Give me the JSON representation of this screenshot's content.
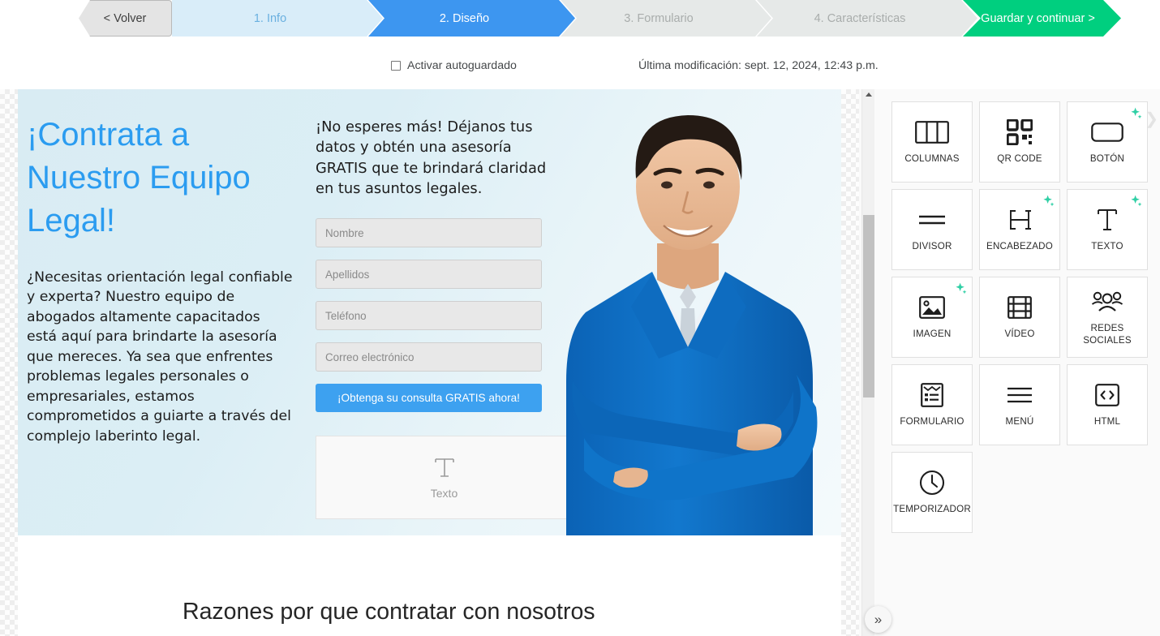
{
  "topbar": {
    "back_label": "< Volver",
    "steps": [
      {
        "label": "1. Info",
        "state": "done"
      },
      {
        "label": "2. Diseño",
        "state": "active"
      },
      {
        "label": "3. Formulario",
        "state": "pending"
      },
      {
        "label": "4. Características",
        "state": "pending"
      }
    ],
    "save_label": "Guardar y continuar >",
    "autosave_label": "Activar autoguardado",
    "autosave_checked": false,
    "last_modified": "Última modificación: sept. 12, 2024, 12:43 p.m."
  },
  "canvas": {
    "hero": {
      "heading": "¡Contrata a Nuestro Equipo Legal!",
      "paragraph": "¿Necesitas orientación legal confiable y experta? Nuestro equipo de abogados altamente capacitados está aquí para brindarte la asesoría que mereces. Ya sea que enfrentes problemas legales personales o empresariales, estamos comprometidos a guiarte a través del complejo laberinto legal.",
      "form_lead": "¡No esperes más! Déjanos tus datos y obtén una asesoría GRATIS que te brindará claridad en tus asuntos legales.",
      "fields": [
        {
          "placeholder": "Nombre"
        },
        {
          "placeholder": "Apellidos"
        },
        {
          "placeholder": "Teléfono"
        },
        {
          "placeholder": "Correo electrónico"
        }
      ],
      "cta_label": "¡Obtenga su consulta GRATIS ahora!",
      "text_block_label": "Texto",
      "text_block_icon": "text-t-icon"
    },
    "section_two_title": "Razones por que contratar con nosotros"
  },
  "scroll": {
    "up_arrow_icon": "caret-up-icon",
    "expand_icon": "double-chevron-right-icon",
    "expand_label": "»"
  },
  "panel": {
    "collapse_icon": "chevron-right-icon",
    "widgets": [
      {
        "label": "COLUMNAS",
        "icon": "columns-icon",
        "ai": false
      },
      {
        "label": "QR CODE",
        "icon": "qr-code-icon",
        "ai": false
      },
      {
        "label": "BOTÓN",
        "icon": "button-icon",
        "ai": true
      },
      {
        "label": "DIVISOR",
        "icon": "divider-icon",
        "ai": false
      },
      {
        "label": "ENCABEZADO",
        "icon": "heading-h-icon",
        "ai": true
      },
      {
        "label": "TEXTO",
        "icon": "text-t-icon",
        "ai": true
      },
      {
        "label": "IMAGEN",
        "icon": "image-icon",
        "ai": true
      },
      {
        "label": "VÍDEO",
        "icon": "video-film-icon",
        "ai": false
      },
      {
        "label": "REDES SOCIALES",
        "icon": "social-people-icon",
        "ai": false
      },
      {
        "label": "FORMULARIO",
        "icon": "form-icon",
        "ai": false
      },
      {
        "label": "MENÚ",
        "icon": "menu-hamburger-icon",
        "ai": false
      },
      {
        "label": "HTML",
        "icon": "code-brackets-icon",
        "ai": false
      },
      {
        "label": "TEMPORIZADOR",
        "icon": "clock-icon",
        "ai": false
      }
    ]
  },
  "colors": {
    "step_active": "#3d96f0",
    "step_done": "#d9edf9",
    "step_pending": "#e6e9e8",
    "save_green": "#00cf7f",
    "heading_blue": "#2b9cf0",
    "cta_blue": "#3da1f0",
    "ai_sparkle": "#2fcfa5"
  }
}
